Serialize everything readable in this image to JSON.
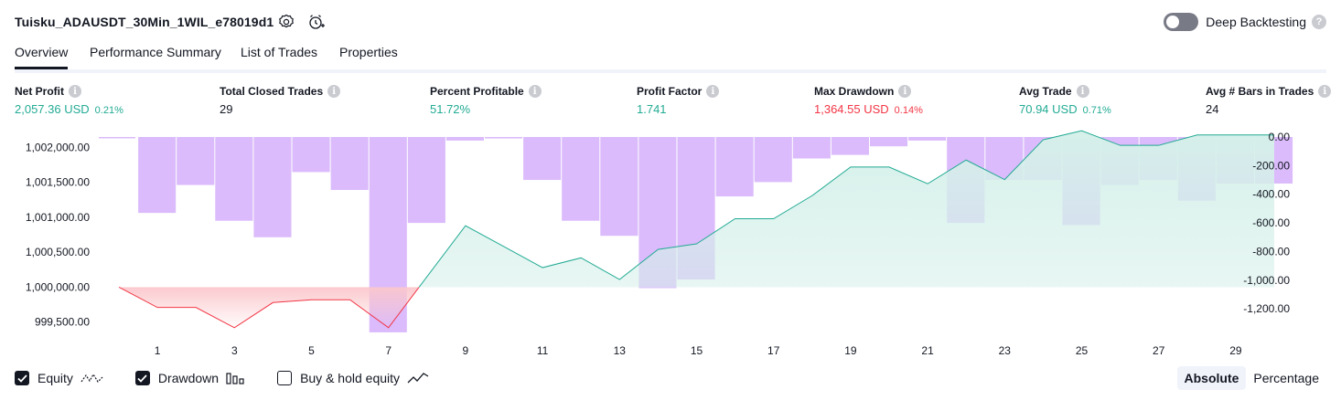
{
  "header": {
    "strategy_title": "Tuisku_ADAUSDT_30Min_1WIL_e78019d1",
    "deep_backtesting_label": "Deep Backtesting",
    "help_glyph": "?"
  },
  "tabs": [
    {
      "label": "Overview",
      "active": true
    },
    {
      "label": "Performance Summary",
      "active": false
    },
    {
      "label": "List of Trades",
      "active": false
    },
    {
      "label": "Properties",
      "active": false
    }
  ],
  "stats": [
    {
      "label": "Net Profit",
      "value": "2,057.36 USD",
      "pct": "0.21%",
      "tone": "green"
    },
    {
      "label": "Total Closed Trades",
      "value": "29",
      "pct": "",
      "tone": "dark"
    },
    {
      "label": "Percent Profitable",
      "value": "51.72%",
      "pct": "",
      "tone": "green"
    },
    {
      "label": "Profit Factor",
      "value": "1.741",
      "pct": "",
      "tone": "green"
    },
    {
      "label": "Max Drawdown",
      "value": "1,364.55 USD",
      "pct": "0.14%",
      "tone": "red"
    },
    {
      "label": "Avg Trade",
      "value": "70.94 USD",
      "pct": "0.71%",
      "tone": "green"
    },
    {
      "label": "Avg # Bars in Trades",
      "value": "24",
      "pct": "",
      "tone": "dark"
    }
  ],
  "legend": [
    {
      "label": "Equity",
      "checked": true,
      "icon": "equity-line-icon"
    },
    {
      "label": "Drawdown",
      "checked": true,
      "icon": "drawdown-bars-icon"
    },
    {
      "label": "Buy & hold equity",
      "checked": false,
      "icon": "buy-hold-line-icon"
    }
  ],
  "view_toggle": {
    "absolute_label": "Absolute",
    "percentage_label": "Percentage",
    "selected": "Absolute"
  },
  "colors": {
    "profit_line": "#22ab94",
    "loss_line": "#f23645",
    "drawdown_bar": "#d7b4fb",
    "equity_fill": "#d5f0ea",
    "loss_fill": "#fbc7cc"
  },
  "chart_data": {
    "type": "line",
    "x": [
      0,
      1,
      2,
      3,
      4,
      5,
      6,
      7,
      8,
      9,
      10,
      11,
      12,
      13,
      14,
      15,
      16,
      17,
      18,
      19,
      20,
      21,
      22,
      23,
      24,
      25,
      26,
      27,
      28,
      29,
      30
    ],
    "x_tick_labels": [
      "1",
      "3",
      "5",
      "7",
      "9",
      "11",
      "13",
      "15",
      "17",
      "19",
      "21",
      "23",
      "25",
      "27",
      "29"
    ],
    "x_tick_values": [
      1,
      3,
      5,
      7,
      9,
      11,
      13,
      15,
      17,
      19,
      21,
      23,
      25,
      27,
      29
    ],
    "left_axis": {
      "ylim": [
        999300,
        1002150
      ],
      "tick_labels": [
        "1,002,000.00",
        "1,001,500.00",
        "1,001,000.00",
        "1,000,500.00",
        "1,000,000.00",
        "999,500.00"
      ],
      "tick_values": [
        1002000,
        1001500,
        1001000,
        1000500,
        1000000,
        999500
      ]
    },
    "right_axis": {
      "ylim": [
        -1390,
        0
      ],
      "inverted": true,
      "tick_labels": [
        "0.00",
        "-200.00",
        "-400.00",
        "-600.00",
        "-800.00",
        "-1,000.00",
        "-1,200.00"
      ],
      "tick_values": [
        0,
        -200,
        -400,
        -600,
        -800,
        -1000,
        -1200
      ]
    },
    "baseline": 1000000,
    "series": [
      {
        "name": "Equity",
        "axis": "left",
        "values": [
          1000000,
          999710,
          999710,
          999420,
          999780,
          999820,
          999820,
          999420,
          1000150,
          1000880,
          1000580,
          1000280,
          1000420,
          1000110,
          1000540,
          1000620,
          1000980,
          1000980,
          1001310,
          1001720,
          1001720,
          1001480,
          1001820,
          1001540,
          1002110,
          1002240,
          1002030,
          1002030,
          1002180,
          1002180,
          1002180
        ]
      },
      {
        "name": "Drawdown",
        "type": "bar",
        "axis": "right",
        "values": [
          -3,
          -530,
          -335,
          -585,
          -700,
          -245,
          -370,
          -1364,
          -600,
          -25,
          -10,
          -300,
          -585,
          -690,
          -1055,
          -995,
          -415,
          -315,
          -150,
          -125,
          -65,
          -25,
          -600,
          -300,
          -300,
          -615,
          -335,
          -300,
          -445,
          -325,
          -325
        ]
      }
    ],
    "grid": false
  }
}
